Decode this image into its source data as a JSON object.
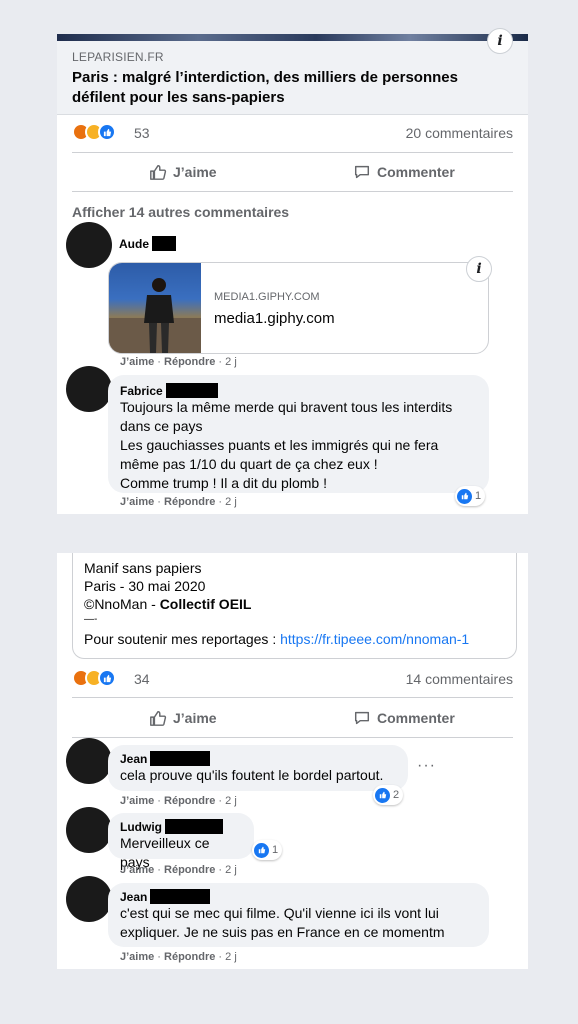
{
  "panel1": {
    "link_preview": {
      "domain": "LEPARISIEN.FR",
      "title": "Paris : malgré l’interdiction, des milliers de personnes défilent pour les sans-papiers"
    },
    "reactions_count": "53",
    "comments_count": "20 commentaires",
    "like_label": "J’aime",
    "comment_label": "Commenter",
    "more_comments": "Afficher 14 autres commentaires",
    "comments": [
      {
        "author": "Aude",
        "giphy_domain": "MEDIA1.GIPHY.COM",
        "giphy_title": "media1.giphy.com",
        "like": "J’aime",
        "reply": "Répondre",
        "time": "2 j"
      },
      {
        "author": "Fabrice",
        "lines": [
          "Toujours la même merde qui bravent tous les interdits",
          "dans ce pays",
          "Les gauchiasses puants et les immigrés qui ne fera",
          "même pas 1/10 du quart de ça chez eux !",
          "Comme trump ! Il a dit du plomb !"
        ],
        "reaction_count": "1",
        "like": "J’aime",
        "reply": "Répondre",
        "time": "2 j"
      }
    ]
  },
  "panel2": {
    "post_lines": [
      "Manif sans papiers",
      "Paris - 30 mai 2020"
    ],
    "credit_prefix": "©NnoMan - ",
    "credit_bold": "Collectif OEIL",
    "separator": "—-",
    "support_text": "Pour soutenir mes reportages : ",
    "support_link": "https://fr.tipeee.com/nnoman-1",
    "reactions_count": "34",
    "comments_count": "14 commentaires",
    "like_label": "J’aime",
    "comment_label": "Commenter",
    "comments": [
      {
        "author": "Jean",
        "text": "cela prouve qu'ils foutent le bordel partout.",
        "reaction_count": "2",
        "like": "J’aime",
        "reply": "Répondre",
        "time": "2 j"
      },
      {
        "author": "Ludwig",
        "text": "Merveilleux ce pays",
        "reaction_count": "1",
        "like": "J’aime",
        "reply": "Répondre",
        "time": "2 j"
      },
      {
        "author": "Jean",
        "lines": [
          "c'est qui se mec qui filme. Qu'il vienne ici ils vont lui",
          "expliquer. Je ne suis pas en France en ce momentm"
        ],
        "like": "J’aime",
        "reply": "Répondre",
        "time": "2 j"
      }
    ]
  },
  "icons": {
    "info": "i",
    "more": "···"
  },
  "colors": {
    "accent": "#1877f2",
    "background": "#e9ebf0"
  }
}
